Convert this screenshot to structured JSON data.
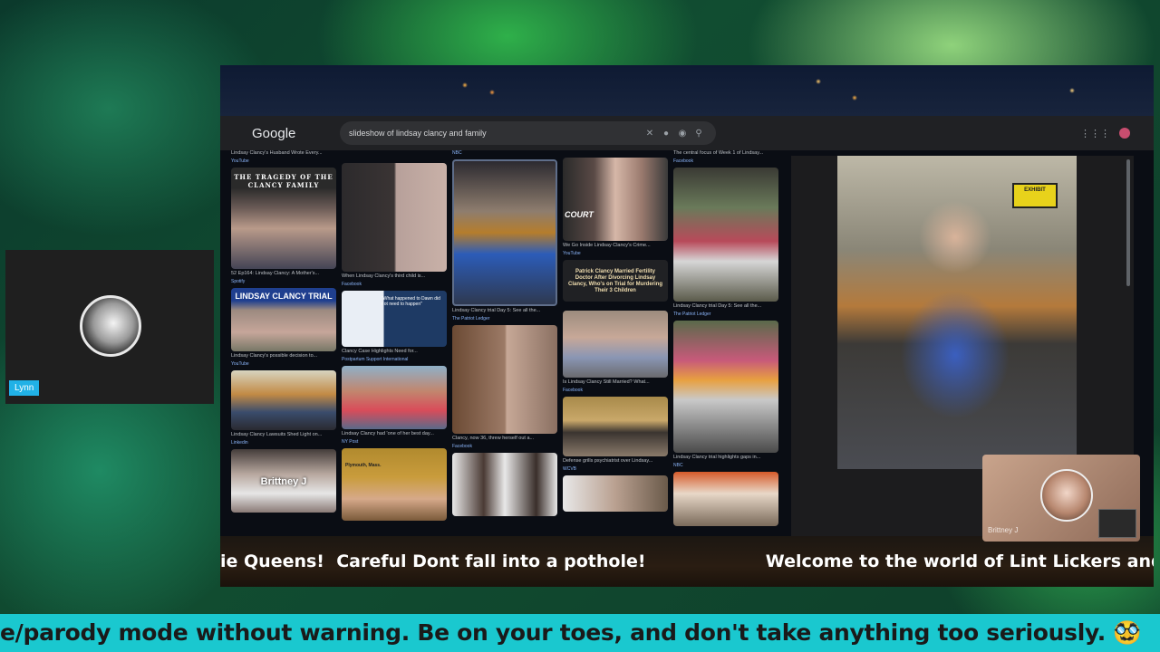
{
  "google": {
    "logo": "Google",
    "query": "slideshow of lindsay clancy and family"
  },
  "results": {
    "columns": [
      [
        {
          "kind": "top_caption",
          "caption": "Lindsay Clancy's Husband Wrote Every...",
          "source": "YouTube"
        },
        {
          "kind": "image",
          "caption": "52 Ep164: Lindsay Clancy: A Mother's...",
          "source": "Spotify",
          "overlay": "THE TRAGEDY OF THE CLANCY FAMILY"
        },
        {
          "kind": "image",
          "caption": "Lindsay Clancy's possible decision to...",
          "source": "YouTube",
          "overlay": "LINDSAY CLANCY TRIAL"
        },
        {
          "kind": "image",
          "caption": "Lindsay Clancy Lawsuits Shed Light on...",
          "source": "Linkedin"
        },
        {
          "kind": "image",
          "caption": "",
          "source": "",
          "overlay": "Brittney J"
        }
      ],
      [
        {
          "kind": "image",
          "caption": "When Lindsay Clancy's third child is...",
          "source": "Facebook"
        },
        {
          "kind": "image",
          "caption": "Clancy Case Highlights Need for...",
          "source": "Postpartum Support International",
          "overlay": "\"What happened to Dawn did not need to happen\""
        },
        {
          "kind": "image",
          "caption": "Lindsay Clancy had 'one of her best day...",
          "source": "NY Post"
        },
        {
          "kind": "image",
          "caption": "",
          "source": "",
          "overlay": "Plymouth, Mass."
        }
      ],
      [
        {
          "kind": "top_caption",
          "caption": "",
          "source": "NBC"
        },
        {
          "kind": "image",
          "caption": "Lindsay Clancy trial Day 5: See all the...",
          "source": "The Patriot Ledger"
        },
        {
          "kind": "image",
          "caption": "Clancy, now 36, threw herself out a...",
          "source": "Facebook"
        },
        {
          "kind": "image",
          "caption": "",
          "source": ""
        }
      ],
      [
        {
          "kind": "image",
          "caption": "We Go Inside Lindsay Clancy's Crime...",
          "source": "YouTube",
          "overlay": "COURT"
        },
        {
          "kind": "text_card",
          "caption": "",
          "source": "",
          "overlay": "Patrick Clancy Married Fertility Doctor After Divorcing Lindsay Clancy, Who's on Trial for Murdering Their 3 Children"
        },
        {
          "kind": "image",
          "caption": "Is Lindsay Clancy Still Married? What...",
          "source": "Facebook"
        },
        {
          "kind": "image",
          "caption": "Defense grills psychiatrist over Lindsay...",
          "source": "WCVB"
        },
        {
          "kind": "image",
          "caption": "",
          "source": ""
        }
      ],
      [
        {
          "kind": "top_caption",
          "caption": "The central focus of Week 1 of Lindsay...",
          "source": "Facebook"
        },
        {
          "kind": "image",
          "caption": "Lindsay Clancy trial Day 5: See all the...",
          "source": "The Patriot Ledger"
        },
        {
          "kind": "image",
          "caption": "Lindsay Clancy trial highlights gaps in...",
          "source": "NBC"
        },
        {
          "kind": "image",
          "caption": "",
          "source": ""
        }
      ]
    ]
  },
  "preview": {
    "exhibit": "EXHIBIT"
  },
  "stream_ticker": "ie Queens!  Careful Dont fall into a pothole!                    Welcome to the world of Lint Lickers and",
  "webcams": {
    "left_name": "Lynn",
    "right_name": "Brittney J"
  },
  "bottom_ticker": "e/parody mode without warning. Be on your toes, and don't take anything too seriously. 🥸"
}
